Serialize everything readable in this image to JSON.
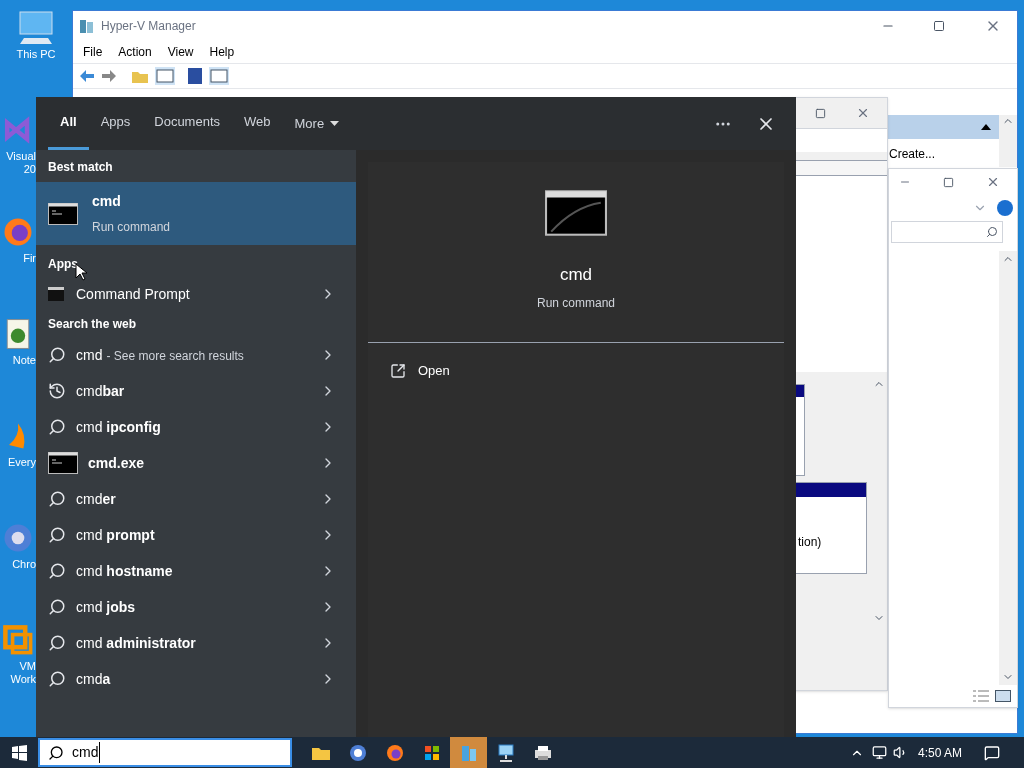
{
  "desktop_icons": [
    {
      "kind": "pc",
      "lines": [
        "This PC"
      ]
    },
    {
      "kind": "studio",
      "lines": [
        "Visual",
        "20"
      ]
    },
    {
      "kind": "browser-fox",
      "lines": [
        "Fir"
      ]
    },
    {
      "kind": "notepad",
      "lines": [
        "Note"
      ]
    },
    {
      "kind": "search-app",
      "lines": [
        "Every"
      ]
    },
    {
      "kind": "browser-round",
      "lines": [
        "Chro"
      ]
    },
    {
      "kind": "vm",
      "lines": [
        "VM",
        "Work"
      ]
    }
  ],
  "hyperv_window": {
    "title": "Hyper-V Manager",
    "menu": [
      "File",
      "Action",
      "View",
      "Help"
    ],
    "action_item": "Create..."
  },
  "back_window": {
    "text": "tion)"
  },
  "start_menu": {
    "tabs": [
      {
        "label": "All",
        "selected": true
      },
      {
        "label": "Apps",
        "selected": false
      },
      {
        "label": "Documents",
        "selected": false
      },
      {
        "label": "Web",
        "selected": false
      }
    ],
    "more": "More",
    "best_match": {
      "heading": "Best match",
      "title": "cmd",
      "subtitle": "Run command",
      "selected": true
    },
    "apps": {
      "heading": "Apps",
      "items": [
        {
          "label": "Command Prompt"
        }
      ]
    },
    "web": {
      "heading": "Search the web",
      "items": [
        {
          "kind": "search",
          "text": "cmd",
          "suffix": "- See more search results"
        },
        {
          "kind": "history",
          "text": "cmd**bar**"
        },
        {
          "kind": "search",
          "text": "cmd **ipconfig**"
        },
        {
          "kind": "app",
          "text": "**cmd.exe**"
        },
        {
          "kind": "search",
          "text": "cmd**er**"
        },
        {
          "kind": "search",
          "text": "cmd **prompt**"
        },
        {
          "kind": "search",
          "text": "cmd **hostname**"
        },
        {
          "kind": "search",
          "text": "cmd **jobs**"
        },
        {
          "kind": "search",
          "text": "cmd **administrator**"
        },
        {
          "kind": "search",
          "text": "cmd**a**"
        }
      ]
    },
    "preview": {
      "title": "cmd",
      "subtitle": "Run command",
      "actions": [
        {
          "label": "Open"
        }
      ]
    }
  },
  "taskbar": {
    "search_value": "cmd",
    "apps": [
      {
        "kind": "folder",
        "selected": false
      },
      {
        "kind": "browser-round",
        "selected": false
      },
      {
        "kind": "browser-fox",
        "selected": false
      },
      {
        "kind": "store",
        "selected": false
      },
      {
        "kind": "hyperv",
        "selected": true
      },
      {
        "kind": "network",
        "selected": false
      },
      {
        "kind": "printer",
        "selected": false
      }
    ],
    "time": "4:50 AM"
  }
}
